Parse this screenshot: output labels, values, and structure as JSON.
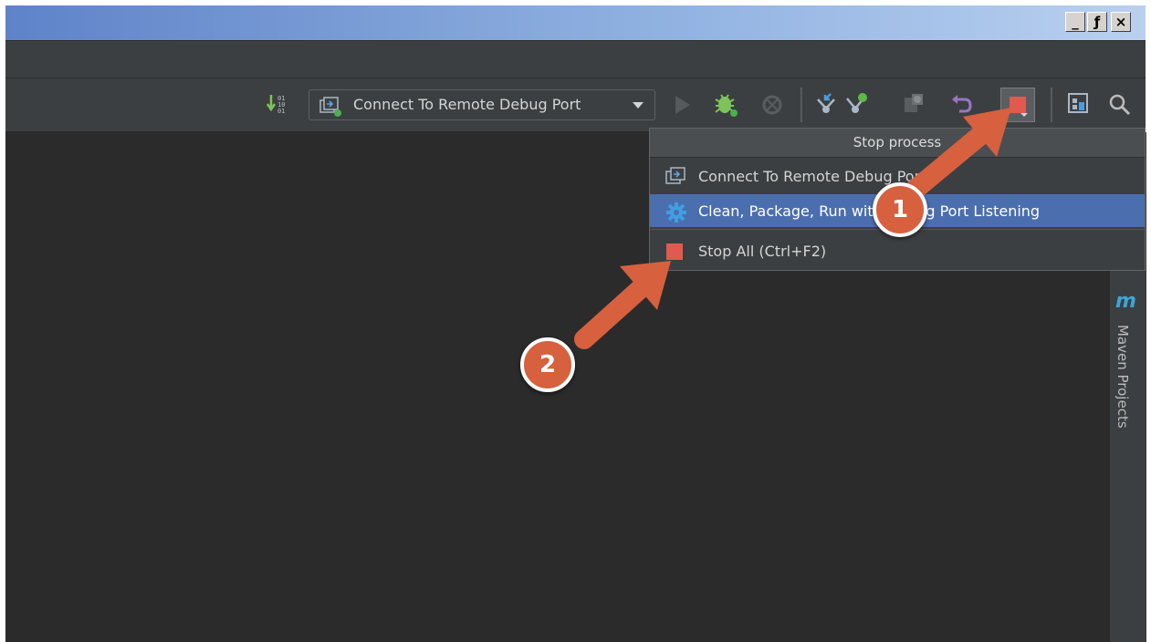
{
  "window": {
    "minimize_label": "_",
    "restore_label": "ƒ",
    "close_label": "×"
  },
  "toolbar": {
    "run_config_label": "Connect To Remote Debug Port",
    "icons": [
      "sort-icon",
      "remote-debug-icon",
      "dropdown-arrow-icon",
      "run-icon",
      "debug-icon",
      "coverage-icon",
      "vcs-update-icon",
      "vcs-commit-icon",
      "vcs-compare-icon",
      "vcs-revert-icon",
      "stop-icon",
      "project-structure-icon",
      "search-icon"
    ]
  },
  "popup": {
    "title": "Stop process",
    "items": [
      {
        "label": "Connect To Remote Debug Port",
        "icon": "remote-debug-icon"
      },
      {
        "label": "Clean, Package, Run with Debug Port Listening",
        "icon": "gear-icon",
        "selected": true
      },
      {
        "label": "Stop All (Ctrl+F2)",
        "icon": "stop-square-icon"
      }
    ]
  },
  "sidebar": {
    "maven_icon": "m",
    "maven_label": "Maven Projects"
  },
  "annotations": [
    {
      "label": "1"
    },
    {
      "label": "2"
    }
  ],
  "colors": {
    "accent_arrow": "#d7603e",
    "selection": "#4b6eaf",
    "background": "#2b2b2b",
    "toolbar": "#3c3f41"
  }
}
